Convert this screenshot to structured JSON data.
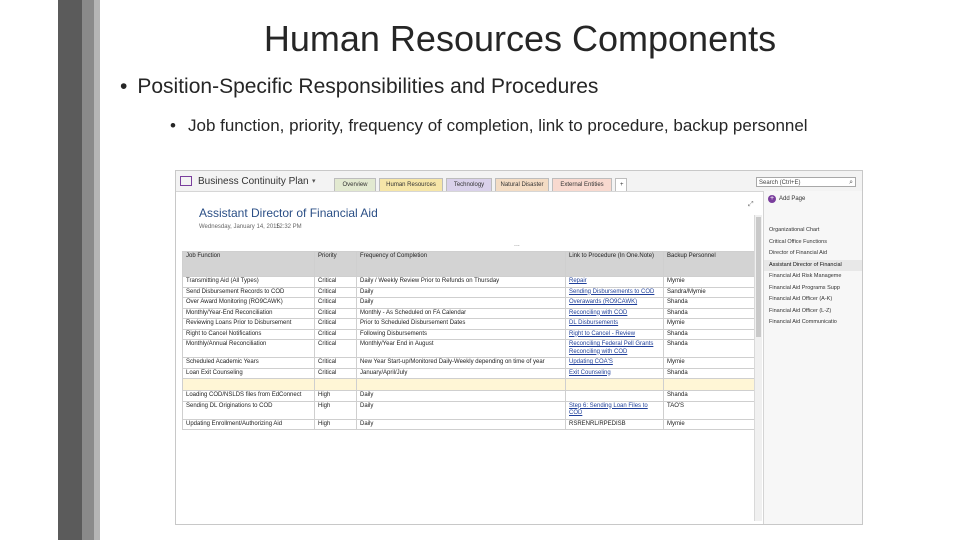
{
  "slide": {
    "title": "Human Resources Components",
    "bullet1": "Position-Specific Responsibilities and Procedures",
    "bullet2": "Job function, priority, frequency of completion, link to procedure, backup personnel",
    "bullet_char": "•",
    "deco_colors": [
      "#5b5b5b",
      "#8a8a8a",
      "#b5b5b5"
    ]
  },
  "onenote": {
    "notebook_name": "Business Continuity Plan",
    "caret": "▾",
    "tabs": [
      {
        "label": "Overview",
        "color": "#e2e9d0"
      },
      {
        "label": "Human Resources",
        "color": "#f6e6a8"
      },
      {
        "label": "Technology",
        "color": "#d9d1ea"
      },
      {
        "label": "Natural Disaster",
        "color": "#f3dcc4"
      },
      {
        "label": "External Entities",
        "color": "#f8d9cf"
      },
      {
        "label": "+",
        "color": "#ffffff"
      }
    ],
    "search_placeholder": "Search (Ctrl+E)",
    "search_icon": "search-icon",
    "page": {
      "title": "Assistant Director of Financial Aid",
      "date": "Wednesday, January 14, 2015",
      "time": "12:32 PM",
      "dots": "...",
      "expand_icon": "expand-icon"
    },
    "table": {
      "headers": [
        "Job Function",
        "Priority",
        "Frequency of Completion",
        "Link to Procedure (In One.Note)",
        "Backup Personnel"
      ],
      "rows": [
        {
          "cells": [
            "Transmitting Aid (All Types)",
            "Critical",
            "Daily / Weekly Review Prior to Refunds on Thursday",
            "Repair",
            "Mymie"
          ],
          "link": true,
          "highlight": false
        },
        {
          "cells": [
            "Send Disbursement Records to COD",
            "Critical",
            "Daily",
            "Sending Disbursements to COD",
            "Sandra/Mymie"
          ],
          "link": true,
          "highlight": false
        },
        {
          "cells": [
            "Over Award Monitoring (RO9CAWK)",
            "Critical",
            "Daily",
            "Overawards (RO9CAWK)",
            "Shanda"
          ],
          "link": true,
          "highlight": false
        },
        {
          "cells": [
            "Monthly/Year-End Reconciliation",
            "Critical",
            "Monthly - As Scheduled on FA Calendar",
            "Reconciling with COD",
            "Shanda"
          ],
          "link": true,
          "highlight": false
        },
        {
          "cells": [
            "Reviewing Loans Prior to Disbursement",
            "Critical",
            "Prior to Scheduled Disbursement Dates",
            "DL Disbursements",
            "Mymie"
          ],
          "link": true,
          "highlight": false
        },
        {
          "cells": [
            "Right to Cancel Notifications",
            "Critical",
            "Following Disbursements",
            "Right to Cancel - Review",
            "Shanda"
          ],
          "link": true,
          "highlight": false
        },
        {
          "cells": [
            "Monthly/Annual Reconciliation",
            "Critical",
            "Monthly/Year End in August",
            "Reconciling Federal Pell Grants Reconciling with COD",
            "Shanda"
          ],
          "link": true,
          "highlight": false
        },
        {
          "cells": [
            "Scheduled Academic Years",
            "Critical",
            "New Year Start-up/Monitored Daily-Weekly depending on time of year",
            "Updating COA'S",
            "Mymie"
          ],
          "link": true,
          "highlight": false
        },
        {
          "cells": [
            "Loan Exit Counseling",
            "Critical",
            "January/April/July",
            "Exit Counseling",
            "Shanda"
          ],
          "link": true,
          "highlight": false
        },
        {
          "cells": [
            "",
            "",
            "",
            "",
            ""
          ],
          "link": false,
          "highlight": true
        },
        {
          "cells": [
            "Loading COD/NSLDS files from EdConnect",
            "High",
            "Daily",
            "",
            "Shanda"
          ],
          "link": false,
          "highlight": false
        },
        {
          "cells": [
            "Sending DL Originations to COD",
            "High",
            "Daily",
            "Step 6: Sending Loan Files to COD",
            "TAO'S"
          ],
          "link": true,
          "highlight": false
        },
        {
          "cells": [
            "Updating Enrollment/Authorizing Aid",
            "High",
            "Daily",
            "RSRENRL/RPEDISB",
            "Mymie"
          ],
          "link": false,
          "highlight": false
        }
      ]
    },
    "pages_pane": {
      "add_label": "Add Page",
      "items": [
        {
          "label": "Organizational Chart",
          "selected": false
        },
        {
          "label": "Critical Office Functions",
          "selected": false
        },
        {
          "label": "Director of Financial Aid",
          "selected": false
        },
        {
          "label": "Assistant Director of Financial",
          "selected": true
        },
        {
          "label": "Financial Aid Risk Manageme",
          "selected": false
        },
        {
          "label": "Financial Aid Programs Supp",
          "selected": false
        },
        {
          "label": "Financial Aid Officer (A-K)",
          "selected": false
        },
        {
          "label": "Financial Aid Officer (L-Z)",
          "selected": false
        },
        {
          "label": "Financial Aid Communicatio",
          "selected": false
        }
      ]
    }
  }
}
